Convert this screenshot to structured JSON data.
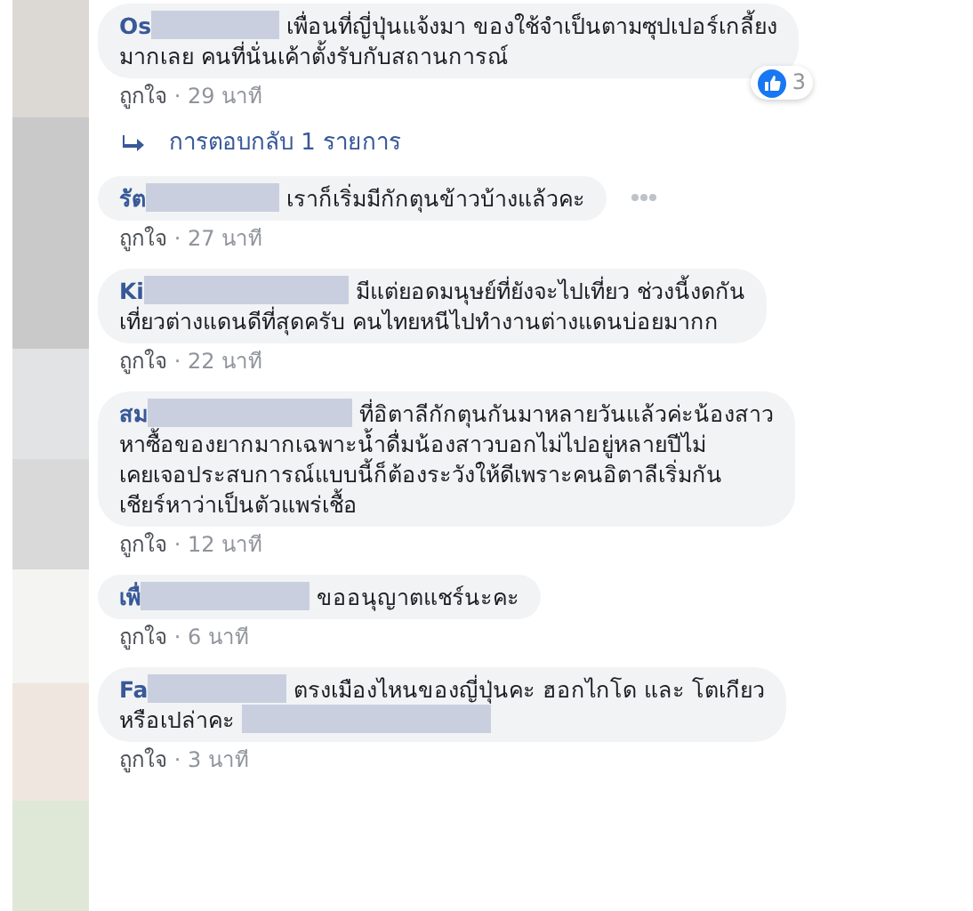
{
  "comments": [
    {
      "name": "Os",
      "lines": [
        [
          {
            "kind": "redacted"
          },
          {
            "kind": "text",
            "text": "เพื่อนที่ญี่ปุ่นแจ้งมา ของใช้จำเป็นตามซุปเปอร์เกลี้ยง"
          }
        ],
        [
          {
            "kind": "text",
            "text": "มากเลย คนที่นั่นเค้าตั้งรับกับสถานการณ์"
          }
        ]
      ],
      "reaction": {
        "count": "3"
      },
      "like": "ถูกใจ",
      "separator": "·",
      "time": "29 นาที",
      "replies": "การตอบกลับ 1 รายการ"
    },
    {
      "name": "รัต",
      "lines": [
        [
          {
            "kind": "redacted"
          },
          {
            "kind": "text",
            "text": "เราก็เริ่มมีกักตุนข้าวบ้างแล้วคะ"
          }
        ]
      ],
      "more": true,
      "like": "ถูกใจ",
      "separator": "·",
      "time": "27 นาที"
    },
    {
      "name": "Ki",
      "lines": [
        [
          {
            "kind": "redacted"
          },
          {
            "kind": "text",
            "text": "มีแต่ยอดมนุษย์ที่ยังจะไปเที่ยว ช่วงนี้งดกัน"
          }
        ],
        [
          {
            "kind": "text",
            "text": "เที่ยวต่างแดนดีที่สุดครับ คนไทยหนีไปทำงานต่างแดนบ่อยมากก"
          }
        ]
      ],
      "like": "ถูกใจ",
      "separator": "·",
      "time": "22 นาที"
    },
    {
      "name": "สม",
      "lines": [
        [
          {
            "kind": "redacted"
          },
          {
            "kind": "text",
            "text": "ที่อิตาลีกักตุนกันมาหลายวันแล้วค่ะน้องสาว"
          }
        ],
        [
          {
            "kind": "text",
            "text": "หาซื้อของยากมากเฉพาะน้ำดื่มน้องสาวบอกไม่ไปอยู่หลายปีไม่"
          }
        ],
        [
          {
            "kind": "text",
            "text": "เคยเจอประสบการณ์แบบนี้ก็ต้องระวังให้ดีเพราะคนอิตาลีเริ่มกัน"
          }
        ],
        [
          {
            "kind": "text",
            "text": "เชียร์หาว่าเป็นตัวแพร่เชื้อ"
          }
        ]
      ],
      "like": "ถูกใจ",
      "separator": "·",
      "time": "12 นาที"
    },
    {
      "name": "เพื่",
      "lines": [
        [
          {
            "kind": "redacted"
          },
          {
            "kind": "text",
            "text": "ขออนุญาตแชร์นะคะ"
          }
        ]
      ],
      "like": "ถูกใจ",
      "separator": "·",
      "time": "6 นาที"
    },
    {
      "name": "Fa",
      "lines": [
        [
          {
            "kind": "redacted"
          },
          {
            "kind": "text",
            "text": "ตรงเมืองไหนของญี่ปุ่นคะ ฮอกไกโด และ โตเกียว"
          }
        ],
        [
          {
            "kind": "text",
            "text": "หรือเปล่าคะ"
          },
          {
            "kind": "redacted"
          }
        ]
      ],
      "like": "ถูกใจ",
      "separator": "·",
      "time": "3 นาที"
    }
  ]
}
